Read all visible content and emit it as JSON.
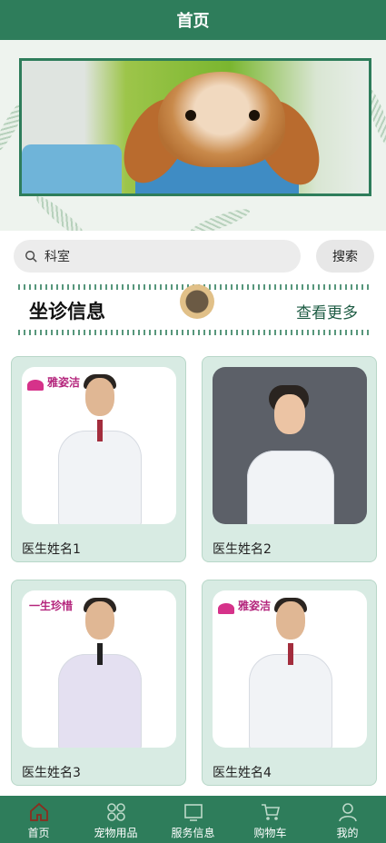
{
  "header": {
    "title": "首页"
  },
  "search": {
    "value": "科室",
    "button_label": "搜索"
  },
  "section": {
    "title": "坐诊信息",
    "more_label": "查看更多"
  },
  "doctors": [
    {
      "name": "医生姓名1",
      "logo": "雅姿洁"
    },
    {
      "name": "医生姓名2"
    },
    {
      "name": "医生姓名3",
      "logo": "一生珍惜"
    },
    {
      "name": "医生姓名4",
      "logo": "雅姿洁"
    }
  ],
  "tabbar": {
    "items": [
      {
        "label": "首页",
        "icon": "home-icon"
      },
      {
        "label": "宠物用品",
        "icon": "grid-icon"
      },
      {
        "label": "服务信息",
        "icon": "monitor-icon"
      },
      {
        "label": "购物车",
        "icon": "cart-icon"
      },
      {
        "label": "我的",
        "icon": "user-icon"
      }
    ]
  },
  "colors": {
    "primary": "#2e7d5b",
    "card_bg": "#d8ebe3",
    "active_icon": "#8b2d1f"
  }
}
